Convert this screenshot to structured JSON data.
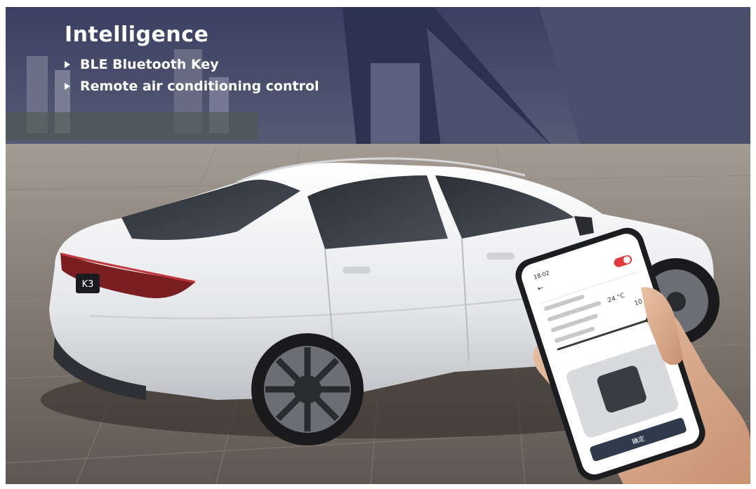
{
  "headline": {
    "title": "Intelligence",
    "bullets": [
      {
        "icon": "triangle-bullet-icon",
        "text": "BLE Bluetooth Key"
      },
      {
        "icon": "triangle-bullet-icon",
        "text": "Remote air conditioning control"
      }
    ]
  },
  "car": {
    "badge": "K3"
  },
  "phone": {
    "status_time": "18:02",
    "temperature": "24 °C",
    "duration": "10",
    "toggle_on": true,
    "bottom_button": "确定"
  },
  "colors": {
    "sky": "#3b3f62",
    "car_body": "#f2f2f4",
    "tail_light": "#7a1e22",
    "toggle": "#e03a3a",
    "pavement": "#7c736c"
  }
}
